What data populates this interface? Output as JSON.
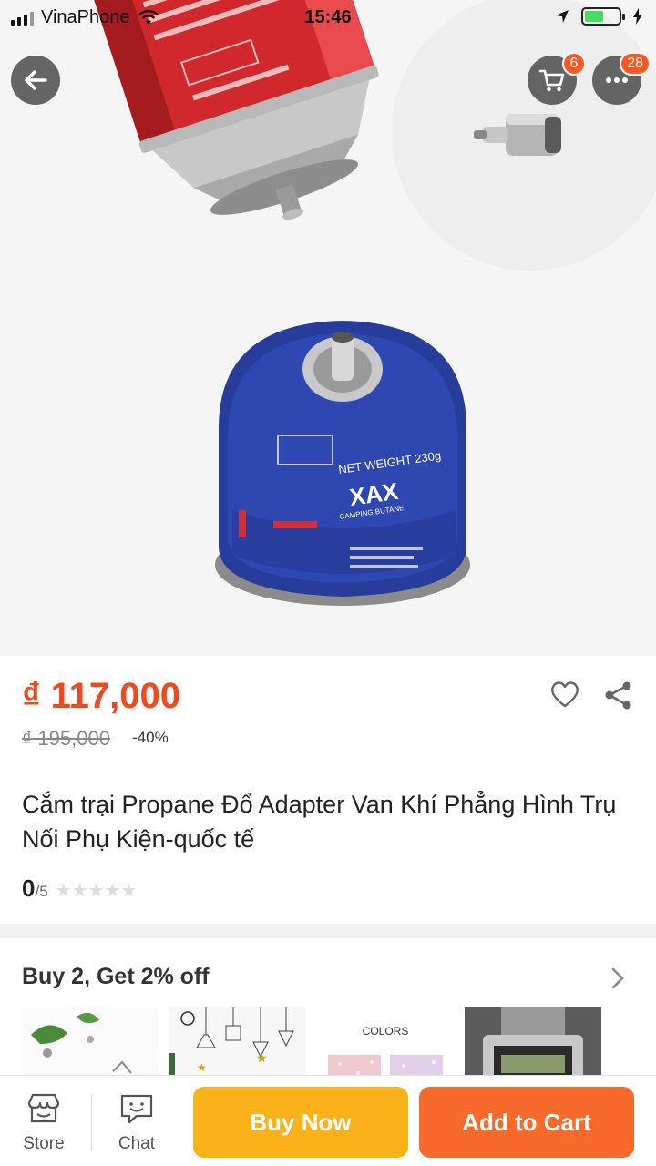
{
  "status_bar": {
    "carrier": "VinaPhone",
    "time": "15:46",
    "battery_level": 0.55
  },
  "header": {
    "back_icon": "arrow-left-icon",
    "cart_icon": "cart-icon",
    "cart_badge": "6",
    "more_icon": "more-icon",
    "more_badge": "28"
  },
  "product": {
    "price": "₫ 117,000",
    "original_price": "₫ 195,000",
    "discount": "-40%",
    "title": "Cắm trại Propane Đổ Adapter Van Khí Phẳng Hình Trụ Nối Phụ Kiện-quốc tế",
    "rating_value": "0",
    "rating_max": "/5",
    "stars": "★★★★★",
    "image_text": {
      "net_weight": "NET WEIGHT 230g",
      "brand": "XAX",
      "brand_sub": "CAMPING BUTANE",
      "thumb_colors": "COLORS"
    }
  },
  "promo": {
    "title": "Buy 2, Get 2% off"
  },
  "bottom_bar": {
    "store_label": "Store",
    "chat_label": "Chat",
    "buy_now": "Buy Now",
    "add_to_cart": "Add to Cart"
  },
  "colors": {
    "price": "#f0491f",
    "buy_now": "#fbb119",
    "add_to_cart": "#f76a2b",
    "badge": "#ff5722"
  }
}
